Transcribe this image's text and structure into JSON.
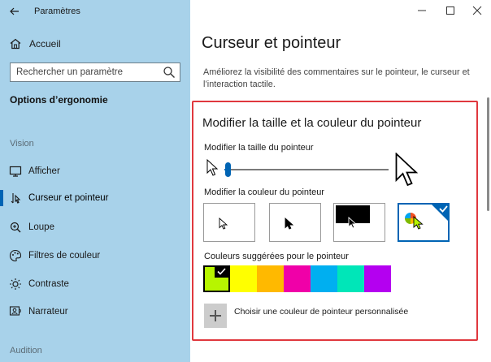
{
  "window": {
    "title": "Paramètres",
    "controls": [
      "minimize",
      "maximize",
      "close"
    ]
  },
  "sidebar": {
    "home_label": "Accueil",
    "search_placeholder": "Rechercher un paramètre",
    "section_title": "Options d’ergonomie",
    "groups": [
      {
        "label": "Vision",
        "items": [
          {
            "label": "Afficher",
            "icon": "monitor-icon"
          },
          {
            "label": "Curseur et pointeur",
            "icon": "cursor-icon",
            "active": true
          },
          {
            "label": "Loupe",
            "icon": "magnifier-icon"
          },
          {
            "label": "Filtres de couleur",
            "icon": "palette-icon"
          },
          {
            "label": "Contraste",
            "icon": "sun-icon"
          },
          {
            "label": "Narrateur",
            "icon": "narrator-icon"
          }
        ]
      },
      {
        "label": "Audition",
        "items": []
      }
    ]
  },
  "main": {
    "title": "Curseur et pointeur",
    "description": "Améliorez la visibilité des commentaires sur le pointeur, le curseur et l’interaction tactile.",
    "section_heading": "Modifier la taille et la couleur du pointeur",
    "size_label": "Modifier la taille du pointeur",
    "size_value_fraction": 0.02,
    "color_label": "Modifier la couleur du pointeur",
    "color_options": [
      {
        "name": "white",
        "selected": false
      },
      {
        "name": "black",
        "selected": false
      },
      {
        "name": "inverted",
        "selected": false
      },
      {
        "name": "custom",
        "selected": true
      }
    ],
    "suggested_label": "Couleurs suggérées pour le pointeur",
    "suggested_colors": [
      "#b7f500",
      "#ffff00",
      "#ffb900",
      "#f000a8",
      "#00aff0",
      "#00e6b8",
      "#b400f0"
    ],
    "selected_color_index": 0,
    "custom_color_label": "Choisir une couleur de pointeur personnalisée",
    "accent_color": "#0064b4",
    "highlight_color": "#e0383e"
  }
}
